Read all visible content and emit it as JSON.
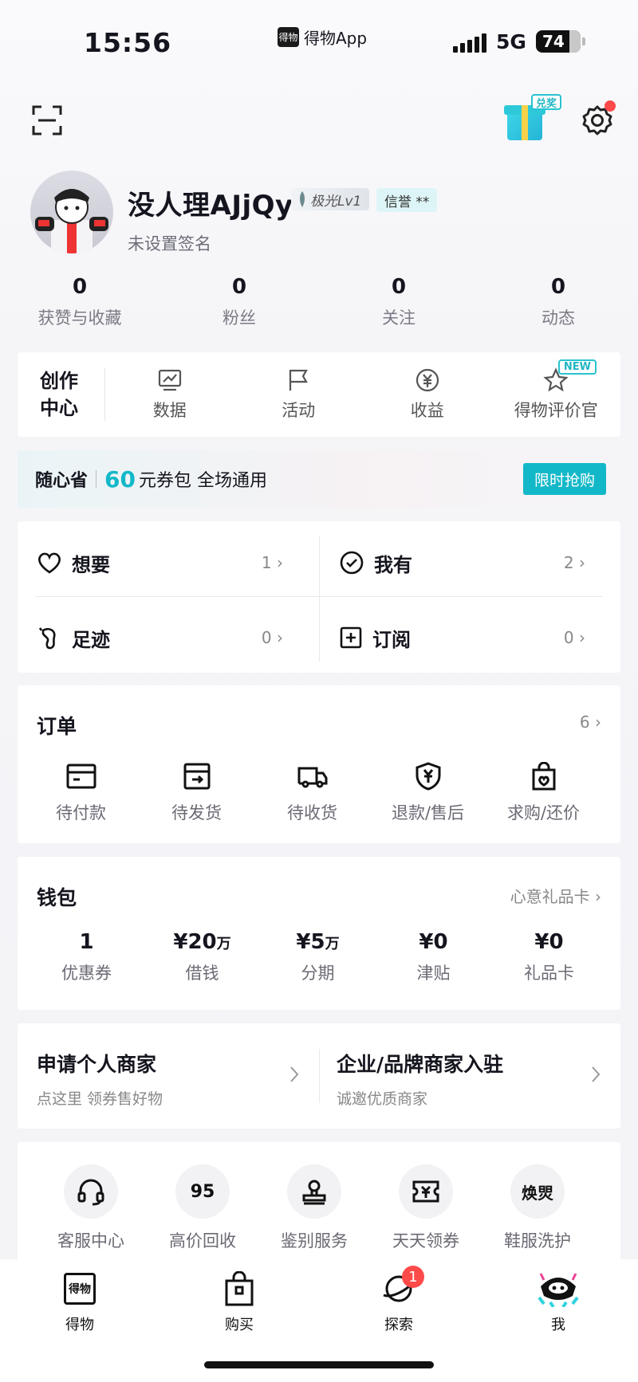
{
  "status_bar": {
    "time": "15:56",
    "app_name": "得物App",
    "app_logo_text": "得物",
    "network": "5G",
    "battery": "74"
  },
  "header": {
    "redeem_label": "兑奖"
  },
  "profile": {
    "username": "没人理AJjQy",
    "level": "极光Lv1",
    "credit": "信誉 **",
    "signature": "未设置签名",
    "stats": [
      {
        "value": "0",
        "label": "获赞与收藏"
      },
      {
        "value": "0",
        "label": "粉丝"
      },
      {
        "value": "0",
        "label": "关注"
      },
      {
        "value": "0",
        "label": "动态"
      }
    ]
  },
  "creator": {
    "title_line1": "创作",
    "title_line2": "中心",
    "items": [
      {
        "label": "数据",
        "icon": "chart-icon"
      },
      {
        "label": "活动",
        "icon": "flag-icon"
      },
      {
        "label": "收益",
        "icon": "yuan-icon"
      },
      {
        "label": "得物评价官",
        "icon": "star-icon",
        "tag": "NEW"
      }
    ]
  },
  "promo": {
    "brand": "随心省",
    "amount": "60",
    "text": "元券包 全场通用",
    "button": "限时抢购",
    "accent": "#13b8c8"
  },
  "collections": [
    {
      "label": "想要",
      "count": "1",
      "icon": "heart-icon"
    },
    {
      "label": "我有",
      "count": "2",
      "icon": "check-circle-icon"
    },
    {
      "label": "足迹",
      "count": "0",
      "icon": "footprint-icon"
    },
    {
      "label": "订阅",
      "count": "0",
      "icon": "subscribe-icon"
    }
  ],
  "orders": {
    "title": "订单",
    "count": "6",
    "items": [
      {
        "label": "待付款",
        "icon": "card-icon"
      },
      {
        "label": "待发货",
        "icon": "box-icon"
      },
      {
        "label": "待收货",
        "icon": "truck-icon"
      },
      {
        "label": "退款/售后",
        "icon": "shield-yuan-icon"
      },
      {
        "label": "求购/还价",
        "icon": "bag-heart-icon"
      }
    ]
  },
  "wallet": {
    "title": "钱包",
    "link": "心意礼品卡",
    "items": [
      {
        "value": "1",
        "unit": "",
        "label": "优惠券"
      },
      {
        "value": "¥20",
        "unit": "万",
        "label": "借钱"
      },
      {
        "value": "¥5",
        "unit": "万",
        "label": "分期"
      },
      {
        "value": "¥0",
        "unit": "",
        "label": "津贴"
      },
      {
        "value": "¥0",
        "unit": "",
        "label": "礼品卡"
      }
    ]
  },
  "merchant": [
    {
      "title": "申请个人商家",
      "subtitle": "点这里 领券售好物"
    },
    {
      "title": "企业/品牌商家入驻",
      "subtitle": "诚邀优质商家"
    }
  ],
  "services": [
    {
      "label": "客服中心",
      "glyph": ""
    },
    {
      "label": "高价回收",
      "glyph": "95"
    },
    {
      "label": "鉴别服务",
      "glyph": ""
    },
    {
      "label": "天天领券",
      "glyph": "¥"
    },
    {
      "label": "鞋服洗护",
      "glyph": "焕焸"
    }
  ],
  "tabbar": {
    "items": [
      {
        "label": "得物",
        "icon_text": "得物"
      },
      {
        "label": "购买"
      },
      {
        "label": "探索",
        "badge": "1"
      },
      {
        "label": "我"
      }
    ]
  }
}
